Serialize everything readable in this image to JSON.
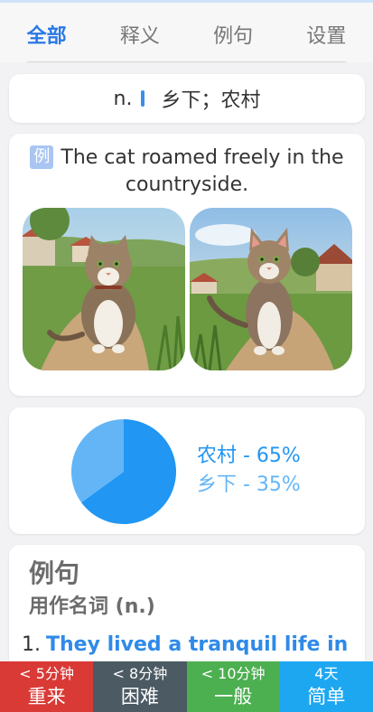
{
  "tabs": [
    "全部",
    "释义",
    "例句",
    "设置"
  ],
  "definition": {
    "pos": "n.",
    "meaning": "乡下；农村"
  },
  "example": {
    "badge": "例",
    "sentence": "The cat roamed freely in the countryside.",
    "images": [
      "cat-countryside-image-1",
      "cat-countryside-image-2"
    ]
  },
  "chart_data": {
    "type": "pie",
    "labels": [
      "农村",
      "乡下"
    ],
    "values": [
      65,
      35
    ],
    "colors": [
      "#2196f3",
      "#64b5f6"
    ]
  },
  "chart_legend": [
    "农村 - 65%",
    "乡下 - 35%"
  ],
  "example_sentences": {
    "title": "例句",
    "subtitle": "用作名词 (n.)",
    "items": [
      {
        "number": "1.",
        "text": "They lived a tranquil life in"
      }
    ]
  },
  "rating_buttons": [
    {
      "time": "< 5分钟",
      "label": "重来",
      "color": "#d93a36"
    },
    {
      "time": "< 8分钟",
      "label": "困难",
      "color": "#4b5a63"
    },
    {
      "time": "< 10分钟",
      "label": "一般",
      "color": "#4caf50"
    },
    {
      "time": "4天",
      "label": "简单",
      "color": "#1ea7f1"
    }
  ]
}
